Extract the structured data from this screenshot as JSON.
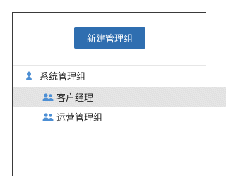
{
  "toolbar": {
    "new_group_label": "新建管理组"
  },
  "tree": {
    "root": {
      "label": "系统管理组",
      "icon": "user-icon"
    },
    "children": [
      {
        "label": "客户经理",
        "icon": "users-group-icon",
        "selected": true
      },
      {
        "label": "运营管理组",
        "icon": "users-group-icon",
        "selected": false
      }
    ]
  },
  "colors": {
    "button": "#2f6eb0",
    "icon": "#4d8fd4",
    "selected_row": "#e3e3e3"
  }
}
